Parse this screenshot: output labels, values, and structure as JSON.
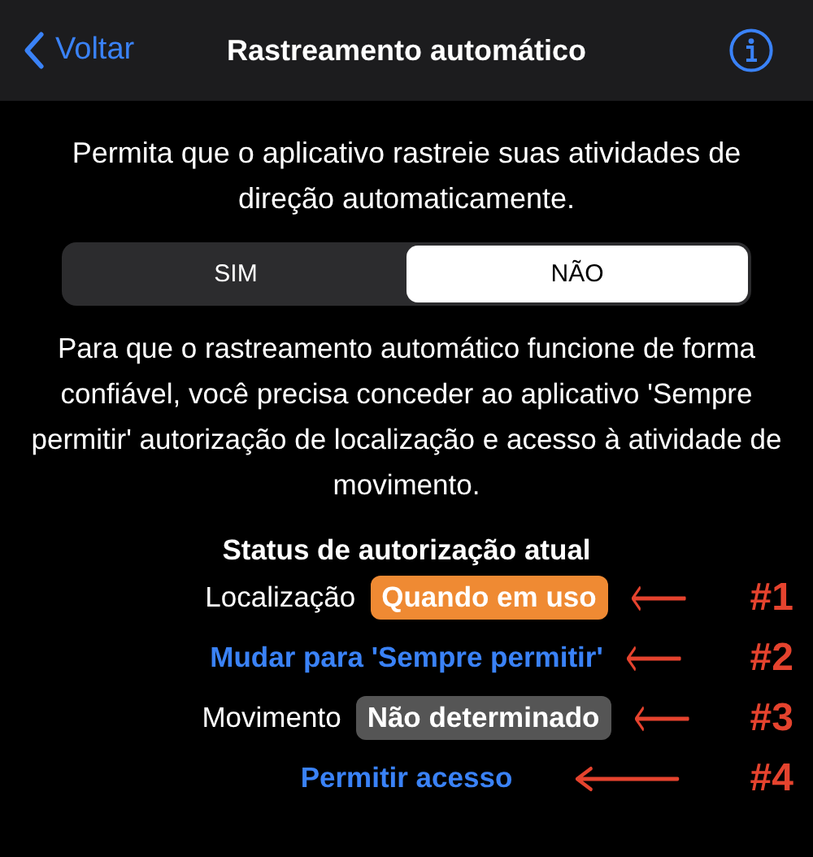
{
  "nav": {
    "back": "Voltar",
    "title": "Rastreamento automático"
  },
  "intro": "Permita que o aplicativo rastreie suas atividades de direção automaticamente.",
  "segments": [
    {
      "label": "SIM",
      "selected": false
    },
    {
      "label": "NÃO",
      "selected": true
    }
  ],
  "explanation": "Para que o rastreamento automático funcione de forma confiável, você precisa conceder ao aplicativo 'Sempre permitir' autorização de localização e acesso à atividade de movimento.",
  "status_heading": "Status de autorização atual",
  "rows": [
    {
      "kind": "status",
      "label": "Localização",
      "badge": "Quando em uso",
      "color": "#ef8a33",
      "annotation": "#1"
    },
    {
      "kind": "link",
      "label": "Mudar para 'Sempre permitir'",
      "annotation": "#2"
    },
    {
      "kind": "status",
      "label": "Movimento",
      "badge": "Não determinado",
      "color": "#555555",
      "annotation": "#3"
    },
    {
      "kind": "link",
      "label": "Permitir acesso",
      "annotation": "#4"
    }
  ]
}
